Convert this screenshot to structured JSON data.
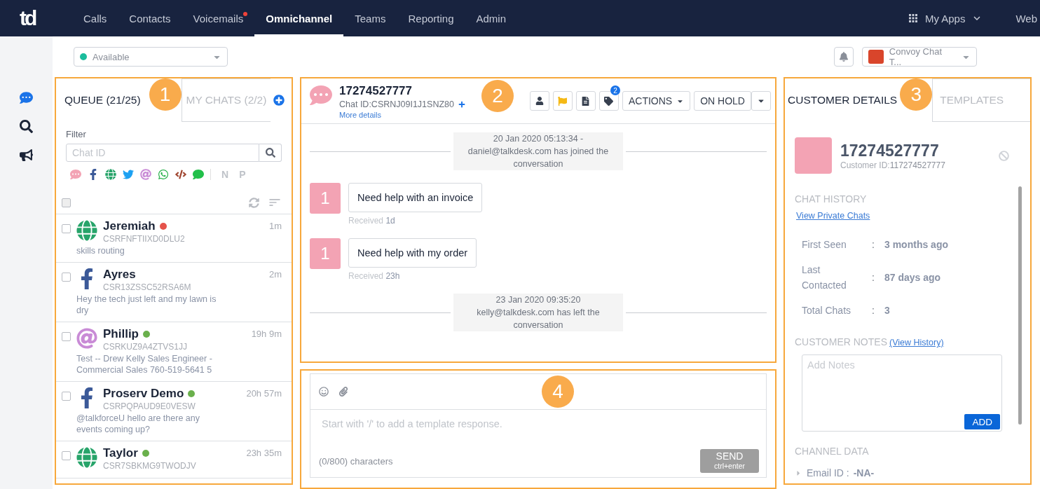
{
  "nav": {
    "items": [
      {
        "label": "Calls",
        "selected": false,
        "notification": false
      },
      {
        "label": "Contacts",
        "selected": false,
        "notification": false
      },
      {
        "label": "Voicemails",
        "selected": false,
        "notification": true
      },
      {
        "label": "Omnichannel",
        "selected": true,
        "notification": false
      },
      {
        "label": "Teams",
        "selected": false,
        "notification": false
      },
      {
        "label": "Reporting",
        "selected": false,
        "notification": false
      },
      {
        "label": "Admin",
        "selected": false,
        "notification": false
      }
    ],
    "apps": "My Apps",
    "cut_item": "Web",
    "logo": "td"
  },
  "rail": [
    {
      "kind": "chat",
      "selected": true
    },
    {
      "kind": "search",
      "selected": false
    },
    {
      "kind": "megaphone",
      "selected": false
    }
  ],
  "status": {
    "value": "Available",
    "color": "#1abc9c"
  },
  "account": {
    "value": "Convoy Chat T..."
  },
  "queue_panel": {
    "callout": "1",
    "tabs": [
      {
        "label": "QUEUE (21/25)",
        "selected": true
      },
      {
        "label": "MY CHATS (2/2)",
        "selected": false
      }
    ],
    "filter_label": "Filter",
    "search_placeholder": "Chat ID",
    "channels": [
      {
        "kind": "chat"
      },
      {
        "kind": "facebook"
      },
      {
        "kind": "web"
      },
      {
        "kind": "twitter"
      },
      {
        "kind": "email"
      },
      {
        "kind": "whatsapp"
      },
      {
        "kind": "code"
      },
      {
        "kind": "sms"
      }
    ],
    "letters": [
      "N",
      "P"
    ],
    "select_all": {
      "checked": false
    },
    "items": [
      {
        "name": "Jeremiah",
        "kind": "web",
        "color": "#e5534b",
        "id": "CSRFNFTIIXD0DLU2",
        "preview": "skills routing",
        "time": "1m",
        "checked": false
      },
      {
        "name": "Ayres",
        "kind": "facebook",
        "id": "CSR13ZSSC52RSA6M",
        "preview": "Hey the tech just left and my lawn is dry",
        "time": "2m",
        "checked": false
      },
      {
        "name": "Phillip",
        "kind": "email",
        "color": "#6ab04c",
        "id": "CSRKUZ9A4ZTVS1JJ",
        "preview": "Test -- Drew Kelly Sales Engineer - Commercial Sales 760-519-5641 5",
        "time": "19h 9m",
        "checked": false
      },
      {
        "name": "Proserv Demo",
        "kind": "facebook",
        "color": "#6ab04c",
        "id": "CSRPQPAUD9E0VESW",
        "preview": "@talkforceU hello are there any events coming up?",
        "time": "20h 57m",
        "checked": false
      },
      {
        "name": "Taylor",
        "kind": "web",
        "color": "#6ab04c",
        "id": "CSR7SBKMG9TWODJV",
        "time": "23h 35m",
        "checked": false
      }
    ]
  },
  "chat_panel": {
    "callout": "2",
    "number": "17274527777",
    "chat_id": "Chat ID:CSRNJ09I1J1SNZ80",
    "more": "More details",
    "tag_count": "2",
    "actions": "ACTIONS",
    "hold": "ON HOLD",
    "events": [
      {
        "kind": "system",
        "text": "20 Jan 2020 05:13:34 - daniel@talkdesk.com has joined the conversation"
      },
      {
        "kind": "message",
        "avatar": "1",
        "text": "Need help with an invoice",
        "received": "Received",
        "age": "1d"
      },
      {
        "kind": "message",
        "avatar": "1",
        "text": "Need help with my order",
        "received": "Received",
        "age": "23h"
      },
      {
        "kind": "system",
        "text": "23 Jan 2020 09:35:20 kelly@talkdesk.com has left the conversation"
      }
    ]
  },
  "composer": {
    "callout": "4",
    "placeholder": "Start with '/' to add a template response.",
    "counter": "(0/800) characters",
    "send": "SEND",
    "send_hint": "ctrl+enter",
    "send_disabled": true
  },
  "details_panel": {
    "callout": "3",
    "tabs": [
      {
        "label": "CUSTOMER DETAILS",
        "selected": true
      },
      {
        "label": "TEMPLATES",
        "selected": false
      }
    ],
    "number": "17274527777",
    "customer_id_label": "Customer ID:",
    "customer_id": "117274527777",
    "history_heading": "CHAT HISTORY",
    "history_link": "View Private Chats",
    "fields": [
      {
        "label": "First Seen",
        "sep": ":",
        "value": "3 months ago"
      },
      {
        "label": "Last Contacted",
        "sep": ":",
        "value": "87 days ago"
      },
      {
        "label": "Total Chats",
        "sep": ":",
        "value": "3"
      }
    ],
    "notes_heading": "CUSTOMER NOTES",
    "notes_link": "(View History)",
    "notes_placeholder": "Add Notes",
    "add": "ADD",
    "channel_heading": "CHANNEL DATA",
    "channel_fields": [
      {
        "label": "Email ID :",
        "value": "-NA-",
        "expanded": false
      }
    ]
  }
}
